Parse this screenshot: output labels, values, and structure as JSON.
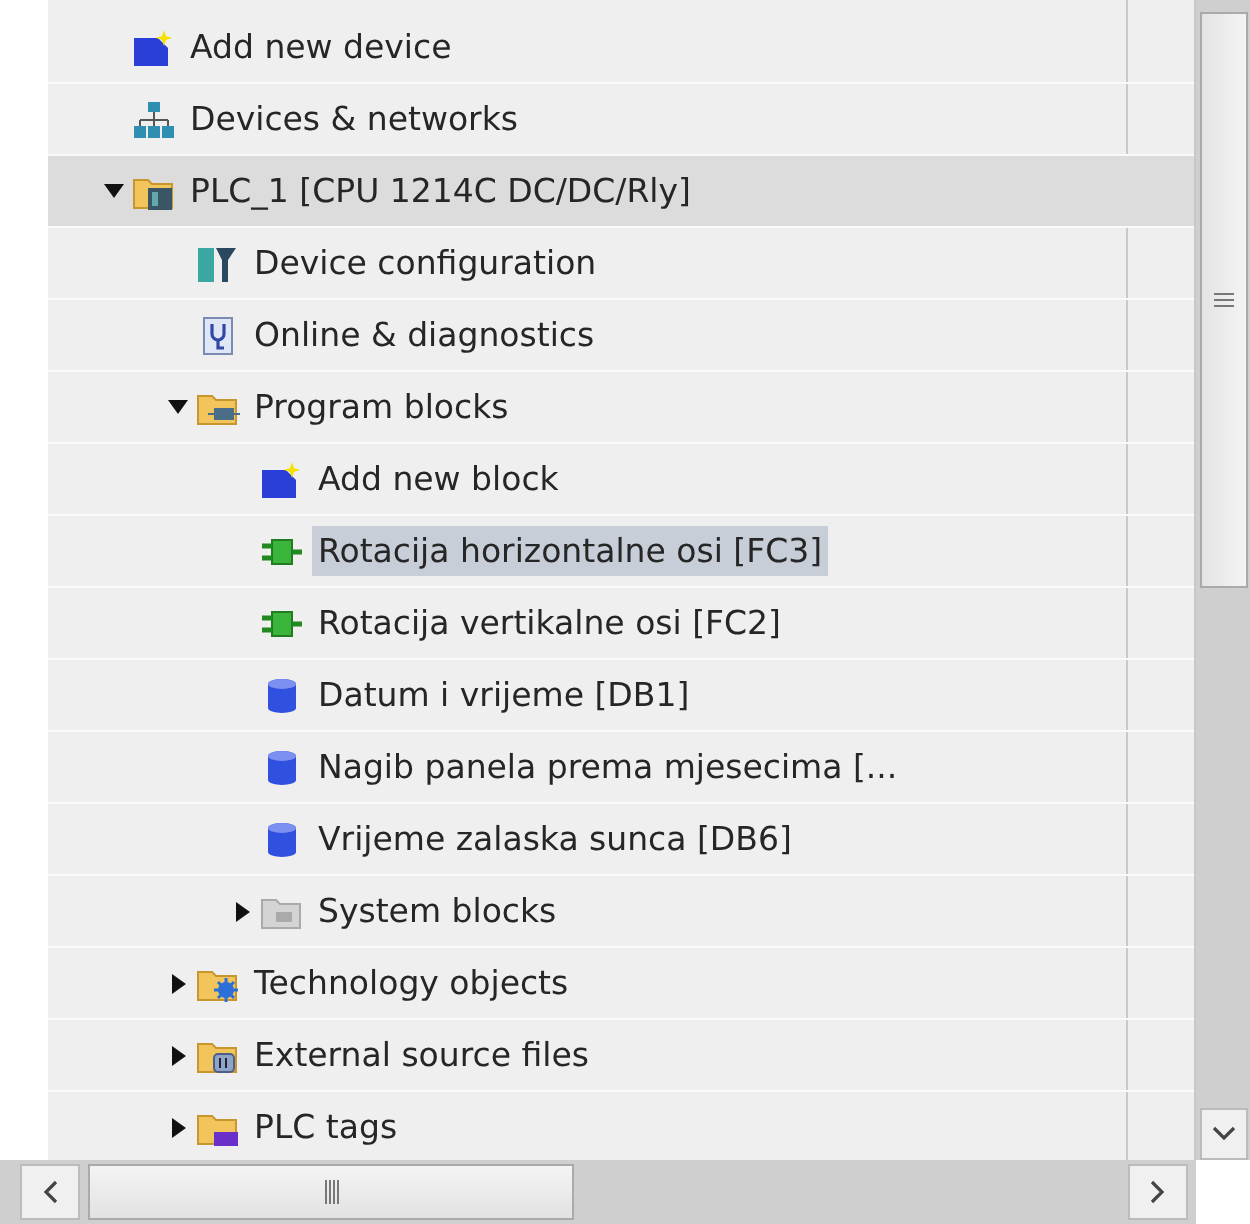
{
  "tree": [
    {
      "label": "Add new device",
      "kind": "add",
      "selected": false,
      "highlighted": false
    },
    {
      "label": "Devices & networks",
      "kind": "network",
      "selected": false,
      "highlighted": false
    },
    {
      "label": "PLC_1 [CPU 1214C DC/DC/Rly]",
      "kind": "plc",
      "expanded": true,
      "selected": true,
      "highlighted": false,
      "children": [
        {
          "label": "Device configuration",
          "kind": "config",
          "selected": false,
          "highlighted": false
        },
        {
          "label": "Online & diagnostics",
          "kind": "online",
          "selected": false,
          "highlighted": false
        },
        {
          "label": "Program blocks",
          "kind": "blocks",
          "expanded": true,
          "selected": false,
          "highlighted": false,
          "children": [
            {
              "label": "Add new block",
              "kind": "add",
              "selected": false,
              "highlighted": false
            },
            {
              "label": "Rotacija horizontalne osi [FC3]",
              "kind": "function",
              "selected": false,
              "highlighted": true
            },
            {
              "label": "Rotacija vertikalne osi [FC2]",
              "kind": "function",
              "selected": false,
              "highlighted": false
            },
            {
              "label": "Datum i vrijeme [DB1]",
              "kind": "db",
              "selected": false,
              "highlighted": false
            },
            {
              "label": "Nagib panela prema mjesecima [...",
              "kind": "db",
              "selected": false,
              "highlighted": false
            },
            {
              "label": "Vrijeme zalaska sunca [DB6]",
              "kind": "db",
              "selected": false,
              "highlighted": false
            },
            {
              "label": "System blocks",
              "kind": "system",
              "expanded": false,
              "selected": false,
              "highlighted": false
            }
          ]
        },
        {
          "label": "Technology objects",
          "kind": "tech",
          "expanded": false,
          "selected": false,
          "highlighted": false
        },
        {
          "label": "External source files",
          "kind": "source",
          "expanded": false,
          "selected": false,
          "highlighted": false
        },
        {
          "label": "PLC tags",
          "kind": "tags",
          "expanded": false,
          "selected": false,
          "highlighted": false
        }
      ]
    }
  ]
}
